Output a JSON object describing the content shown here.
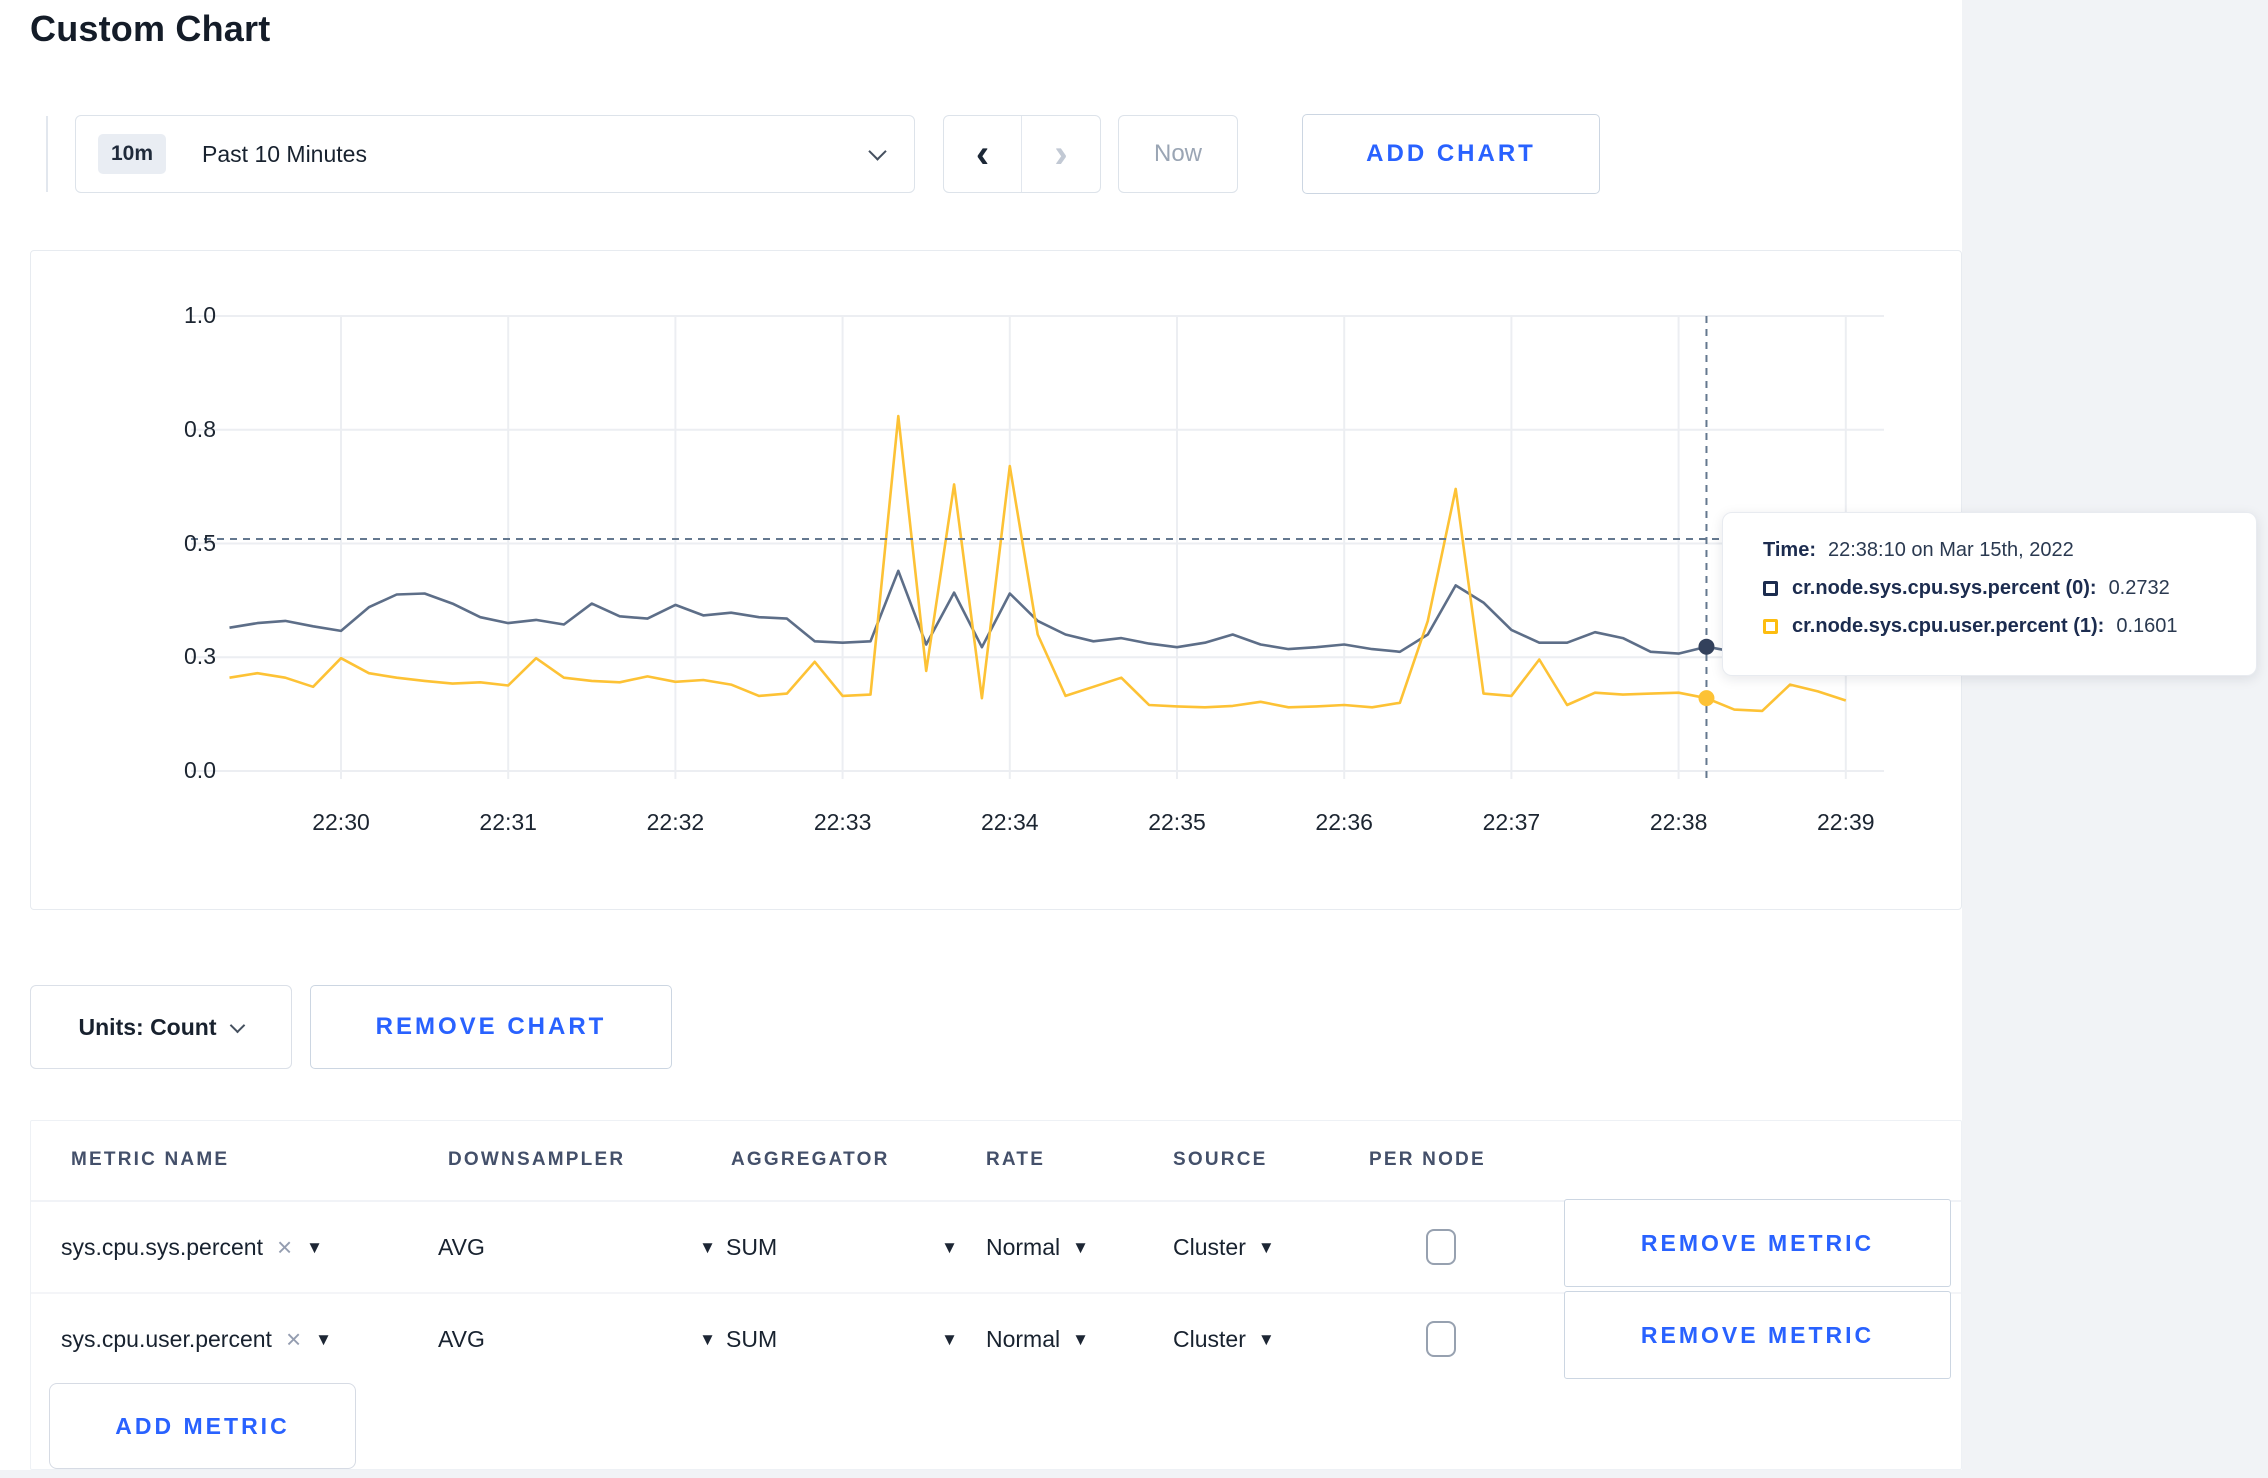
{
  "page": {
    "title": "Custom Chart"
  },
  "toolbar": {
    "time_range": {
      "badge": "10m",
      "label": "Past 10 Minutes"
    },
    "now_label": "Now",
    "add_chart_label": "ADD CHART"
  },
  "glyphs": {
    "dropdown_arrow": "▼",
    "remove_x": "×",
    "prev": "‹",
    "next": "›"
  },
  "chart_data": {
    "type": "line",
    "title": "",
    "xlabel": "",
    "ylabel": "",
    "ylim": [
      0,
      1
    ],
    "grid": true,
    "x_axis": {
      "ticks": [
        "22:30",
        "22:31",
        "22:32",
        "22:33",
        "22:34",
        "22:35",
        "22:36",
        "22:37",
        "22:38",
        "22:39"
      ]
    },
    "y_axis": {
      "tick_labels": [
        "1.0",
        "0.8",
        "0.5",
        "0.3",
        "0.0"
      ],
      "tick_values": [
        1.0,
        0.75,
        0.5,
        0.25,
        0.0
      ]
    },
    "first_sample_time": "22:29:20",
    "sample_interval_seconds": 10,
    "series": [
      {
        "name": "cr.node.sys.cpu.sys.percent",
        "color": "#5d6e88",
        "values": [
          0.315,
          0.325,
          0.33,
          0.318,
          0.308,
          0.36,
          0.388,
          0.39,
          0.368,
          0.338,
          0.325,
          0.332,
          0.322,
          0.368,
          0.34,
          0.335,
          0.365,
          0.342,
          0.348,
          0.338,
          0.335,
          0.285,
          0.282,
          0.285,
          0.44,
          0.278,
          0.392,
          0.272,
          0.39,
          0.33,
          0.3,
          0.285,
          0.292,
          0.28,
          0.272,
          0.282,
          0.3,
          0.278,
          0.268,
          0.272,
          0.278,
          0.268,
          0.262,
          0.3,
          0.408,
          0.37,
          0.31,
          0.282,
          0.282,
          0.305,
          0.292,
          0.262,
          0.258,
          0.2732,
          0.262,
          0.27,
          0.272,
          0.268,
          0.27
        ]
      },
      {
        "name": "cr.node.sys.cpu.user.percent",
        "color": "#fdc235",
        "values": [
          0.205,
          0.215,
          0.205,
          0.185,
          0.248,
          0.215,
          0.205,
          0.198,
          0.192,
          0.195,
          0.188,
          0.248,
          0.205,
          0.198,
          0.195,
          0.208,
          0.196,
          0.2,
          0.19,
          0.165,
          0.17,
          0.24,
          0.165,
          0.168,
          0.78,
          0.22,
          0.63,
          0.16,
          0.67,
          0.3,
          0.165,
          0.185,
          0.205,
          0.145,
          0.142,
          0.14,
          0.143,
          0.152,
          0.14,
          0.142,
          0.145,
          0.14,
          0.15,
          0.33,
          0.62,
          0.17,
          0.165,
          0.245,
          0.145,
          0.172,
          0.168,
          0.17,
          0.172,
          0.1601,
          0.135,
          0.132,
          0.19,
          0.175,
          0.155
        ]
      }
    ],
    "crosshair": {
      "time": "22:38:10",
      "sample_index": 53,
      "hline_value": 0.51,
      "points": [
        {
          "series": 0,
          "value": 0.2732
        },
        {
          "series": 1,
          "value": 0.1601
        }
      ]
    },
    "legend_position": "tooltip"
  },
  "tooltip": {
    "time_label": "Time:",
    "time_value": "22:38:10 on Mar 15th, 2022",
    "rows": [
      {
        "label": "cr.node.sys.cpu.sys.percent (0):",
        "value": "0.2732",
        "color": "#1c2c4f"
      },
      {
        "label": "cr.node.sys.cpu.user.percent (1):",
        "value": "0.1601",
        "color": "#fdbd10"
      }
    ]
  },
  "chart_actions": {
    "units_label": "Units: Count",
    "remove_chart_label": "REMOVE CHART"
  },
  "metrics_table": {
    "headers": [
      "METRIC NAME",
      "DOWNSAMPLER",
      "AGGREGATOR",
      "RATE",
      "SOURCE",
      "PER NODE"
    ],
    "rows": [
      {
        "metric": "sys.cpu.sys.percent",
        "downsampler": "AVG",
        "aggregator": "SUM",
        "rate": "Normal",
        "source": "Cluster",
        "per_node_checked": false,
        "remove_label": "REMOVE METRIC"
      },
      {
        "metric": "sys.cpu.user.percent",
        "downsampler": "AVG",
        "aggregator": "SUM",
        "rate": "Normal",
        "source": "Cluster",
        "per_node_checked": false,
        "remove_label": "REMOVE METRIC"
      }
    ],
    "add_metric_label": "ADD METRIC"
  }
}
